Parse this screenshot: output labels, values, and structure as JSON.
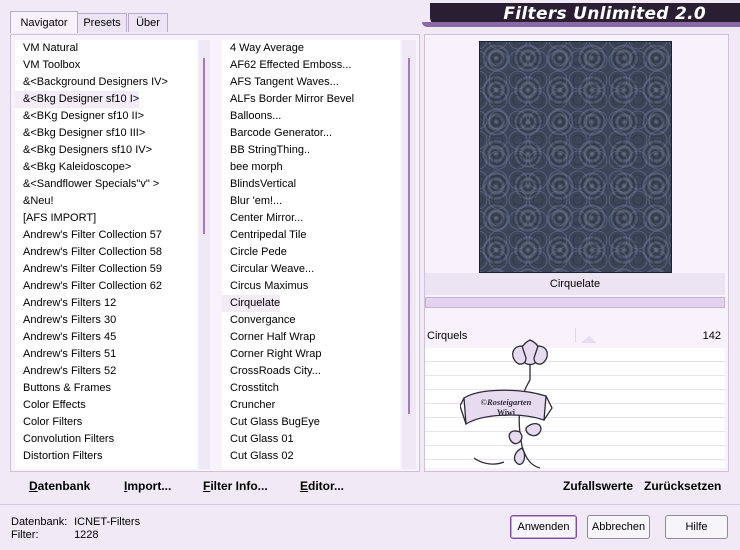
{
  "window": {
    "title": "Filters Unlimited 2.0"
  },
  "tabs": [
    {
      "label": "Navigator",
      "active": true
    },
    {
      "label": "Presets",
      "active": false
    },
    {
      "label": "Über",
      "active": false
    }
  ],
  "categories": [
    "VM Natural",
    "VM Toolbox",
    "&<Background Designers IV>",
    "&<Bkg Designer sf10 I>",
    "&<BKg Designer sf10 II>",
    "&<Bkg Designer sf10 III>",
    "&<Bkg Designers sf10 IV>",
    "&<Bkg Kaleidoscope>",
    "&<Sandflower Specials\"v\" >",
    "&Neu!",
    "[AFS IMPORT]",
    "Andrew's Filter Collection 57",
    "Andrew's Filter Collection 58",
    "Andrew's Filter Collection 59",
    "Andrew's Filter Collection 62",
    "Andrew's Filters 12",
    "Andrew's Filters 30",
    "Andrew's Filters 45",
    "Andrew's Filters 51",
    "Andrew's Filters 52",
    "Buttons & Frames",
    "Color Effects",
    "Color Filters",
    "Convolution Filters",
    "Distortion Filters"
  ],
  "categories_selected_index": 3,
  "filters": [
    "4 Way Average",
    "AF62 Effected Emboss...",
    "AFS Tangent Waves...",
    "ALFs Border Mirror Bevel",
    "Balloons...",
    "Barcode Generator...",
    "BB StringThing..",
    "bee morph",
    "BlindsVertical",
    "Blur 'em!...",
    "Center Mirror...",
    "Centripedal Tile",
    "Circle Pede",
    "Circular Weave...",
    "Circus Maximus",
    "Cirquelate",
    "Convergance",
    "Corner Half Wrap",
    "Corner Right Wrap",
    "CrossRoads City...",
    "Crosstitch",
    "Cruncher",
    "Cut Glass  BugEye",
    "Cut Glass 01",
    "Cut Glass 02"
  ],
  "filters_selected_index": 15,
  "left_buttons": {
    "database": "Datenbank",
    "import": "Import...",
    "filter_info": "Filter Info...",
    "editor": "Editor..."
  },
  "preview": {
    "filter_name": "Cirquelate",
    "param_label": "Cirquels",
    "param_value": "142",
    "param_fraction": 0.56
  },
  "right_buttons": {
    "random": "Zufallswerte",
    "reset": "Zurücksetzen"
  },
  "status": {
    "database_label": "Datenbank:",
    "database_value": "ICNET-Filters",
    "filter_label": "Filter:",
    "filter_value": "1228"
  },
  "dialog_buttons": {
    "apply": "Anwenden",
    "cancel": "Abbrechen",
    "help": "Hilfe"
  },
  "watermark": {
    "text_line1": "©Rosteigarten",
    "text_line2": "Wiwi"
  },
  "colors": {
    "accent": "#a677c6",
    "banner": "#2a1e33",
    "preview_base": "#3b4559"
  }
}
